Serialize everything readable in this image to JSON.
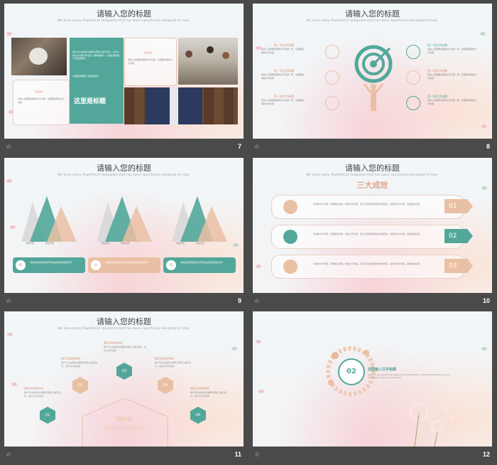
{
  "slides": [
    {
      "number": "7",
      "title": "请输入您的标题",
      "subtitle": "We have many PowerPoint templates that has been specifically designed to help.",
      "teal_text": "用户可以在投影仪或者计算机上进行演示，也可以将演示文稿打印出来，制作成胶片，以便应用到更广泛的领域中。",
      "teal_text2": "以便应用到更广泛的领域中。",
      "teal_heading": "这里是标题",
      "card1_head": "标题文字",
      "card1_text": "您输入您需要说明的文字内容，您需要说明的文字内容",
      "card2_head": "标题文字",
      "card2_text": "您输入您需要说明的文字内容，您需要说明的文字内容"
    },
    {
      "number": "8",
      "title": "请输入您的标题",
      "subtitle": "We have many PowerPoint templates that has been specifically designed to help.",
      "left_items": [
        {
          "head": "您一项文字标题",
          "text": "您输入您需要说明的文字内容一项，您需要说明的文字内容"
        },
        {
          "head": "您一项文字标题",
          "text": "您输入您需要说明的文字内容一项，您需要说明的文字内容"
        },
        {
          "head": "您一项文字标题",
          "text": "您输入您需要说明的文字内容一项，您需要说明的文字内容"
        }
      ],
      "right_items": [
        {
          "head": "您一项文字标题",
          "text": "您输入您需要说明的文字内容一项，您需要说明的文字内容"
        },
        {
          "head": "您一项文字标题",
          "text": "您输入您需要说明的文字内容一项，您需要说明的文字内容"
        },
        {
          "head": "您一项文字标题",
          "text": "您输入您需要说明的文字内容一项，您需要说明的文字内容"
        }
      ]
    },
    {
      "number": "9",
      "title": "请输入您的标题",
      "subtitle": "We have many PowerPoint templates that has been specifically designed to help.",
      "groups": [
        {
          "labels": [
            "添加标题",
            "添加标题"
          ],
          "badge": "01",
          "text": "请在此处添加您的文字请在此处添加您的文字"
        },
        {
          "labels": [
            "添加标题",
            "添加标题"
          ],
          "badge": "02",
          "text": "请在此处添加您的文字请在此处添加您的文字"
        },
        {
          "labels": [
            "添加标题",
            "添加标题"
          ],
          "badge": "03",
          "text": "请在此处添加您的文字请在此处添加您的文字"
        }
      ]
    },
    {
      "number": "10",
      "title": "请输入您的标题",
      "subtitle": "We have many PowerPoint templates that has been specifically designed to help.",
      "heading": "三大成效",
      "rows": [
        {
          "num": "01",
          "text": "请替换文字内容，添加相关标题，修改文字内容，也可以直接复制你的内容到此。请替换文字内容，添加相关标题。"
        },
        {
          "num": "02",
          "text": "请替换文字内容，添加相关标题，修改文字内容，也可以直接复制你的内容到此。请替换文字内容，添加相关标题。"
        },
        {
          "num": "03",
          "text": "请替换文字内容，添加相关标题，修改文字内容，也可以直接复制你的内容到此。请替换文字内容，添加相关标题。"
        }
      ]
    },
    {
      "number": "11",
      "title": "请输入您的标题",
      "subtitle": "We have many PowerPoint templates that has been specifically designed to help.",
      "center_word1": "Work",
      "center_word2": "INTERCROSED",
      "items": [
        {
          "num": "01",
          "head": "INFOGRAPHIC",
          "text": "用户可以在投影仪或者计算机上进行演示，也可以打印出来"
        },
        {
          "num": "02",
          "head": "INFOGRAPHIC",
          "text": "用户可以在投影仪或者计算机上进行演示，也可以打印出来"
        },
        {
          "num": "03",
          "head": "INFOGRAPHIC",
          "text": "用户可以在投影仪或者计算机上进行演示，也可以打印出来"
        },
        {
          "num": "04",
          "head": "INFOGRAPHIC",
          "text": "用户可以在投影仪或者计算机上进行演示，也可以打印出来"
        },
        {
          "num": "05",
          "head": "INFOGRAPHIC",
          "text": "用户可以在投影仪或者计算机上进行演示，也可以打印出来"
        }
      ]
    },
    {
      "number": "12",
      "badge": "02",
      "heading": "这里输入文字标题",
      "text": "Generous and good things happening. Add related title, modify the text content, you can also directly copy your content here."
    }
  ]
}
